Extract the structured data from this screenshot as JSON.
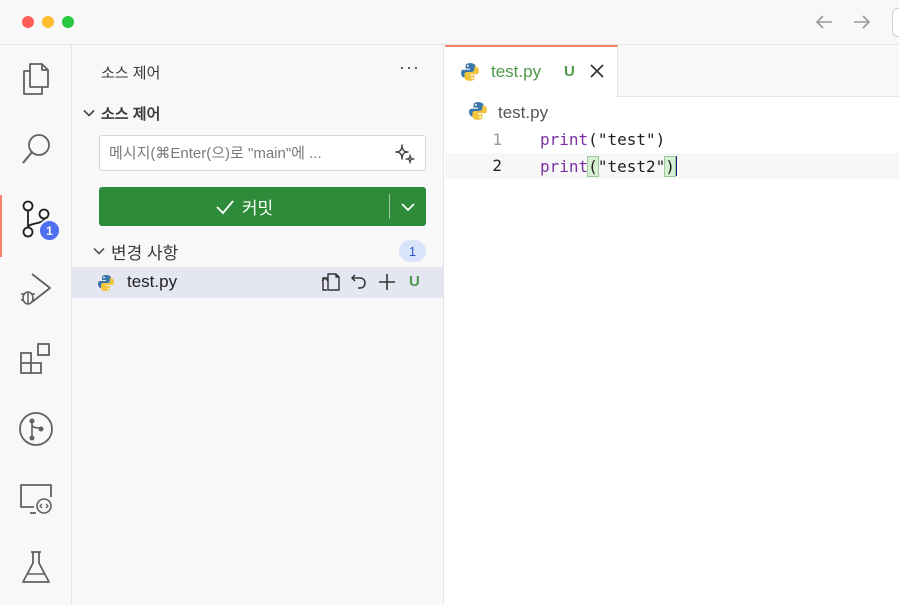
{
  "activity_bar": {
    "items": [
      {
        "name": "explorer",
        "icon": "files-icon"
      },
      {
        "name": "search",
        "icon": "search-icon"
      },
      {
        "name": "source-control",
        "icon": "source-control-icon",
        "badge": "1"
      },
      {
        "name": "run-and-debug",
        "icon": "run-debug-icon"
      },
      {
        "name": "extensions",
        "icon": "extensions-icon"
      },
      {
        "name": "git-graph",
        "icon": "git-graph-icon"
      },
      {
        "name": "remote-explorer",
        "icon": "remote-explorer-icon"
      },
      {
        "name": "testing",
        "icon": "flask-icon"
      }
    ]
  },
  "sidebar": {
    "title": "소스 제어",
    "more_label": "···",
    "section_title": "소스 제어",
    "commit_message_placeholder": "메시지(⌘Enter(으)로 \"main\"에 ...",
    "commit_label": "커밋",
    "changes_label": "변경 사항",
    "changes_count": "1",
    "files": [
      {
        "name": "test.py",
        "status": "U",
        "icon": "python-icon"
      }
    ]
  },
  "editor": {
    "tab": {
      "label": "test.py",
      "status": "U",
      "icon": "python-icon"
    },
    "breadcrumb": "test.py",
    "lines": [
      {
        "number": "1",
        "fn": "print",
        "open": "(",
        "str": "\"test\"",
        "close": ")"
      },
      {
        "number": "2",
        "fn": "print",
        "open": "(",
        "str": "\"test2\"",
        "close": ")"
      }
    ]
  },
  "colors": {
    "commit_button": "#2d8b39",
    "untracked": "#4e9a4b",
    "badge": "#4d6ff0",
    "active_accent": "#f9826c"
  }
}
